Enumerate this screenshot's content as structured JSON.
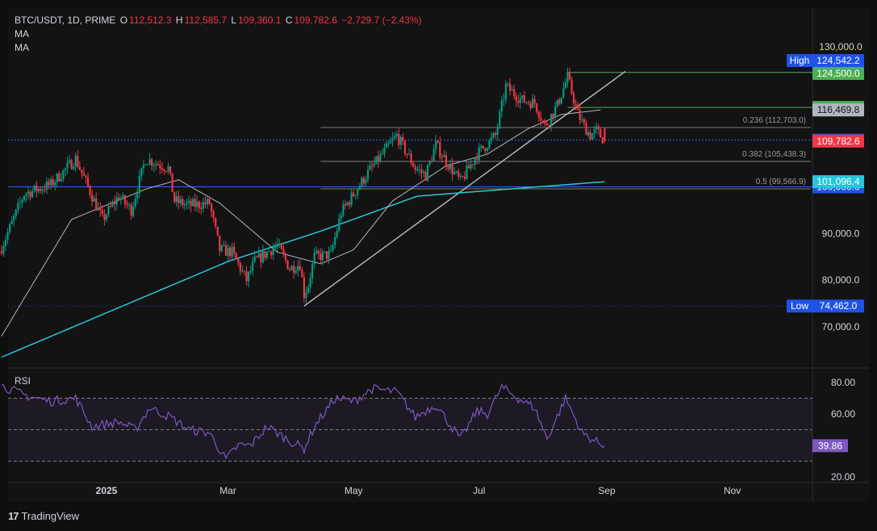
{
  "header": {
    "symbol": "BTC/USDT, 1D, PRIME",
    "o_label": "O",
    "o_value": "112,512.3",
    "h_label": "H",
    "h_value": "112,585.7",
    "l_label": "L",
    "l_value": "109,360.1",
    "c_label": "C",
    "c_value": "109,782.6",
    "change": "−2,729.7 (−2.43%)",
    "ma1": "MA",
    "ma2": "MA"
  },
  "rsi": {
    "label": "RSI",
    "value_label": "39.86",
    "ticks": [
      "80.00",
      "60.00",
      "20.00"
    ]
  },
  "footer": {
    "brand": "TradingView"
  },
  "colors": {
    "up": "#089981",
    "down": "#f23645",
    "ma_slow": "#26c6da",
    "rsi": "#7e57c2"
  },
  "chart_data": {
    "type": "candlestick",
    "symbol": "BTC/USDT",
    "interval": "1D",
    "price_range": [
      60000,
      131500
    ],
    "y_ticks": [
      "130,000.0",
      "90,000.0",
      "80,000.0",
      "70,000.0"
    ],
    "x_ticks": [
      "2025",
      "Mar",
      "May",
      "Jul",
      "Sep",
      "Nov"
    ],
    "x_tick_dates": [
      "2025-01-01",
      "2025-03-01",
      "2025-05-01",
      "2025-07-01",
      "2025-09-01",
      "2025-11-01"
    ],
    "x_range": [
      "2024-11-11",
      "2025-12-15"
    ],
    "last_candle": {
      "date": "2025-08-31",
      "open": 112512.3,
      "high": 112585.7,
      "low": 109360.1,
      "close": 109782.6
    },
    "close_anchors": [
      [
        "2024-11-11",
        87000
      ],
      [
        "2024-11-22",
        98500
      ],
      [
        "2024-12-05",
        100500
      ],
      [
        "2024-12-17",
        106000
      ],
      [
        "2024-12-30",
        93000
      ],
      [
        "2025-01-07",
        98000
      ],
      [
        "2025-01-13",
        95000
      ],
      [
        "2025-01-20",
        106000
      ],
      [
        "2025-01-31",
        104000
      ],
      [
        "2025-02-03",
        97000
      ],
      [
        "2025-02-10",
        96000
      ],
      [
        "2025-02-20",
        96500
      ],
      [
        "2025-02-25",
        86500
      ],
      [
        "2025-03-03",
        86000
      ],
      [
        "2025-03-10",
        80000
      ],
      [
        "2025-03-14",
        84000
      ],
      [
        "2025-03-25",
        87500
      ],
      [
        "2025-03-31",
        82500
      ],
      [
        "2025-04-05",
        83500
      ],
      [
        "2025-04-07",
        77000
      ],
      [
        "2025-04-09",
        79000
      ],
      [
        "2025-04-12",
        85000
      ],
      [
        "2025-04-20",
        85500
      ],
      [
        "2025-04-25",
        94500
      ],
      [
        "2025-05-08",
        103000
      ],
      [
        "2025-05-22",
        111000
      ],
      [
        "2025-05-31",
        104000
      ],
      [
        "2025-06-05",
        102500
      ],
      [
        "2025-06-10",
        109000
      ],
      [
        "2025-06-15",
        105500
      ],
      [
        "2025-06-22",
        101000
      ],
      [
        "2025-06-30",
        107000
      ],
      [
        "2025-07-09",
        111000
      ],
      [
        "2025-07-14",
        121500
      ],
      [
        "2025-07-22",
        118500
      ],
      [
        "2025-07-28",
        118000
      ],
      [
        "2025-08-02",
        113000
      ],
      [
        "2025-08-08",
        117500
      ],
      [
        "2025-08-13",
        123500
      ],
      [
        "2025-08-18",
        115500
      ],
      [
        "2025-08-21",
        113000
      ],
      [
        "2025-08-24",
        111000
      ],
      [
        "2025-08-27",
        112000
      ],
      [
        "2025-08-31",
        109782.6
      ]
    ],
    "ma_fast_anchors": [
      [
        "2024-11-11",
        68000
      ],
      [
        "2024-12-15",
        93000
      ],
      [
        "2025-01-20",
        99500
      ],
      [
        "2025-02-05",
        101500
      ],
      [
        "2025-02-25",
        96500
      ],
      [
        "2025-03-25",
        86000
      ],
      [
        "2025-04-15",
        83500
      ],
      [
        "2025-05-01",
        86500
      ],
      [
        "2025-05-20",
        97000
      ],
      [
        "2025-06-15",
        104500
      ],
      [
        "2025-07-05",
        107000
      ],
      [
        "2025-07-25",
        112500
      ],
      [
        "2025-08-10",
        115500
      ],
      [
        "2025-08-29",
        116469.8
      ]
    ],
    "ma_slow_anchors": [
      [
        "2024-11-11",
        63500
      ],
      [
        "2025-01-01",
        73000
      ],
      [
        "2025-03-01",
        84000
      ],
      [
        "2025-04-15",
        90500
      ],
      [
        "2025-06-01",
        98000
      ],
      [
        "2025-07-15",
        99500
      ],
      [
        "2025-08-31",
        101096.4
      ]
    ],
    "rsi_anchors": [
      [
        "2024-11-11",
        78
      ],
      [
        "2024-11-22",
        72
      ],
      [
        "2024-12-05",
        68
      ],
      [
        "2024-12-17",
        70
      ],
      [
        "2024-12-25",
        52
      ],
      [
        "2025-01-07",
        55
      ],
      [
        "2025-01-15",
        50
      ],
      [
        "2025-01-22",
        64
      ],
      [
        "2025-02-01",
        58
      ],
      [
        "2025-02-10",
        50
      ],
      [
        "2025-02-20",
        48
      ],
      [
        "2025-02-28",
        31
      ],
      [
        "2025-03-06",
        40
      ],
      [
        "2025-03-12",
        40
      ],
      [
        "2025-03-20",
        52
      ],
      [
        "2025-03-31",
        43
      ],
      [
        "2025-04-07",
        38
      ],
      [
        "2025-04-12",
        52
      ],
      [
        "2025-04-22",
        70
      ],
      [
        "2025-05-01",
        68
      ],
      [
        "2025-05-10",
        76
      ],
      [
        "2025-05-22",
        74
      ],
      [
        "2025-05-31",
        58
      ],
      [
        "2025-06-10",
        66
      ],
      [
        "2025-06-22",
        44
      ],
      [
        "2025-06-30",
        62
      ],
      [
        "2025-07-05",
        60
      ],
      [
        "2025-07-12",
        77
      ],
      [
        "2025-07-20",
        70
      ],
      [
        "2025-07-28",
        64
      ],
      [
        "2025-08-03",
        44
      ],
      [
        "2025-08-12",
        70
      ],
      [
        "2025-08-20",
        48
      ],
      [
        "2025-08-26",
        43
      ],
      [
        "2025-08-31",
        39.86
      ]
    ],
    "levels": [
      {
        "name": "resistance",
        "value": 124500,
        "label": "124,500.0",
        "color": "#4caf50",
        "style": "solid"
      },
      {
        "name": "resistance",
        "value": 117000,
        "label": "117,000.0",
        "color": "#4caf50",
        "style": "solid"
      },
      {
        "name": "support",
        "value": 110000,
        "label": "110,000.0",
        "color": "#2962ff",
        "style": "dotted"
      },
      {
        "name": "support",
        "value": 100000,
        "label": "100,000.0",
        "color": "#2962ff",
        "style": "solid"
      }
    ],
    "price_labels": [
      {
        "value": 124542.2,
        "label": "124,542.2",
        "tag": "High",
        "color": "#1e53e5"
      },
      {
        "value": 116469.8,
        "label": "116,469.8",
        "tag": "",
        "color": "#b2b5be"
      },
      {
        "value": 109782.6,
        "label": "109,782.6",
        "tag": "",
        "color": "#f23645"
      },
      {
        "value": 101096.4,
        "label": "101,096.4",
        "tag": "",
        "color": "#26c6da"
      },
      {
        "value": 74462.0,
        "label": "74,462.0",
        "tag": "Low",
        "color": "#1e53e5"
      }
    ],
    "fibonacci": [
      {
        "ratio": 0.236,
        "value": 112703.0,
        "label": "0.236 (112,703.0)"
      },
      {
        "ratio": 0.382,
        "value": 105438.3,
        "label": "0.382 (105,438.3)"
      },
      {
        "ratio": 0.5,
        "value": 99566.9,
        "label": "0.5 (99,566.9)"
      }
    ],
    "fib_range": {
      "high": 124500,
      "low": 74500,
      "start": "2025-04-15",
      "end": "2025-09-01"
    },
    "trendline": {
      "start": [
        "2025-04-07",
        74462
      ],
      "end": [
        "2025-08-31",
        121500
      ]
    }
  }
}
